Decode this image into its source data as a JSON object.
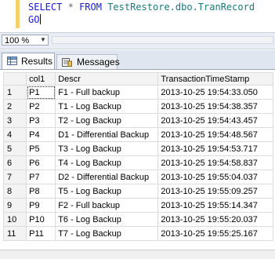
{
  "editor": {
    "line1": {
      "kw1": "SELECT",
      "op": "*",
      "kw2": "FROM",
      "object": "TestRestore.dbo.TranRecord"
    },
    "line2": {
      "kw": "GO"
    }
  },
  "zoom": {
    "value": "100 %"
  },
  "tabs": [
    {
      "label": "Results",
      "active": true
    },
    {
      "label": "Messages",
      "active": false
    }
  ],
  "grid": {
    "columns": [
      "col1",
      "Descr",
      "TransactionTimeStamp"
    ],
    "rows": [
      {
        "n": "1",
        "col1": "P1",
        "descr": "F1 - Full backup",
        "ts": "2013-10-25 19:54:33.050"
      },
      {
        "n": "2",
        "col1": "P2",
        "descr": "T1 - Log Backup",
        "ts": "2013-10-25 19:54:38.357"
      },
      {
        "n": "3",
        "col1": "P3",
        "descr": "T2 - Log Backup",
        "ts": "2013-10-25 19:54:43.457"
      },
      {
        "n": "4",
        "col1": "P4",
        "descr": "D1 - Differential Backup",
        "ts": "2013-10-25 19:54:48.567"
      },
      {
        "n": "5",
        "col1": "P5",
        "descr": "T3 - Log Backup",
        "ts": "2013-10-25 19:54:53.717"
      },
      {
        "n": "6",
        "col1": "P6",
        "descr": "T4 - Log Backup",
        "ts": "2013-10-25 19:54:58.837"
      },
      {
        "n": "7",
        "col1": "P7",
        "descr": "D2 - Differential Backup",
        "ts": "2013-10-25 19:55:04.037"
      },
      {
        "n": "8",
        "col1": "P8",
        "descr": "T5 - Log Backup",
        "ts": "2013-10-25 19:55:09.257"
      },
      {
        "n": "9",
        "col1": "P9",
        "descr": "F2 - Full backup",
        "ts": "2013-10-25 19:55:14.347"
      },
      {
        "n": "10",
        "col1": "P10",
        "descr": "T6 - Log Backup",
        "ts": "2013-10-25 19:55:20.037"
      },
      {
        "n": "11",
        "col1": "P11",
        "descr": "T7 - Log Backup",
        "ts": "2013-10-25 19:55:25.167"
      }
    ]
  }
}
